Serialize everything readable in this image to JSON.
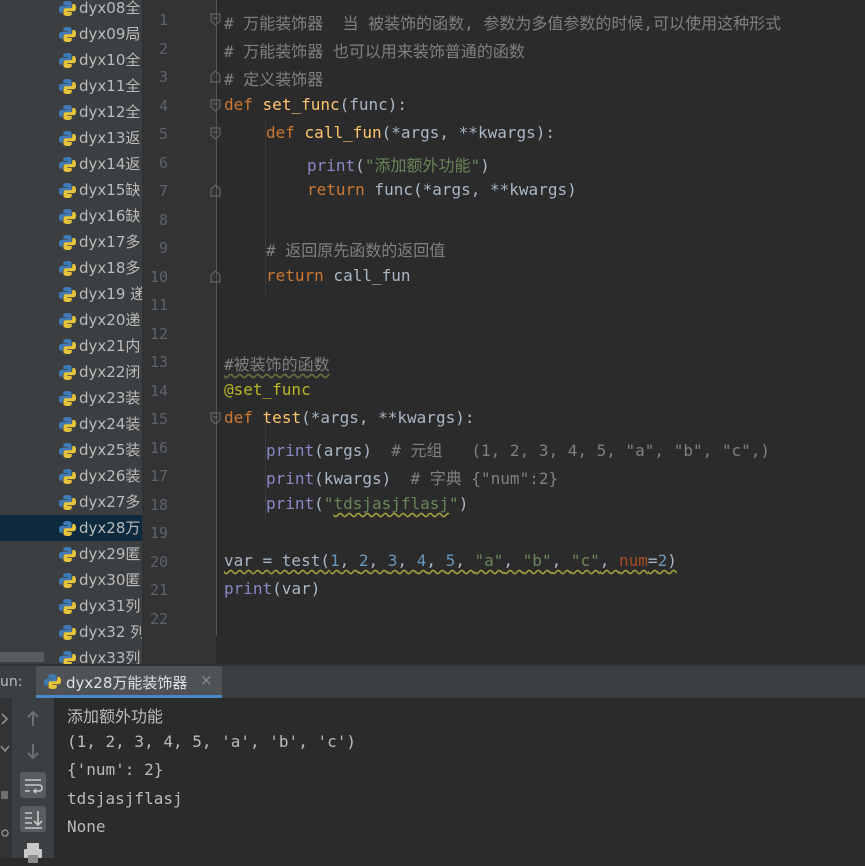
{
  "project_tree": {
    "items": [
      {
        "label": "dyx08全"
      },
      {
        "label": "dyx09局"
      },
      {
        "label": "dyx10全"
      },
      {
        "label": "dyx11全"
      },
      {
        "label": "dyx12全"
      },
      {
        "label": "dyx13返"
      },
      {
        "label": "dyx14返"
      },
      {
        "label": "dyx15缺"
      },
      {
        "label": "dyx16缺"
      },
      {
        "label": "dyx17多"
      },
      {
        "label": "dyx18多"
      },
      {
        "label": "dyx19 递"
      },
      {
        "label": "dyx20递"
      },
      {
        "label": "dyx21内"
      },
      {
        "label": "dyx22闭"
      },
      {
        "label": "dyx23装"
      },
      {
        "label": "dyx24装"
      },
      {
        "label": "dyx25装"
      },
      {
        "label": "dyx26装"
      },
      {
        "label": "dyx27多"
      },
      {
        "label": "dyx28万"
      },
      {
        "label": "dyx29匿"
      },
      {
        "label": "dyx30匿"
      },
      {
        "label": "dyx31列"
      },
      {
        "label": "dyx32 列"
      },
      {
        "label": "dyx33列"
      }
    ],
    "selected_index": 20
  },
  "editor": {
    "line_numbers": [
      "1",
      "2",
      "3",
      "4",
      "5",
      "6",
      "7",
      "8",
      "9",
      "10",
      "11",
      "12",
      "13",
      "14",
      "15",
      "16",
      "17",
      "18",
      "19",
      "20",
      "21",
      "22"
    ],
    "lines": {
      "l1": "# 万能装饰器  当 被装饰的函数, 参数为多值参数的时候,可以使用这种形式",
      "l2": "# 万能装饰器 也可以用来装饰普通的函数",
      "l3": "# 定义装饰器",
      "l4": {
        "kw": "def",
        "name": "set_func",
        "rest": "(func):"
      },
      "l5": {
        "kw": "def",
        "name": "call_fun",
        "rest": "(*args, **kwargs):"
      },
      "l6": {
        "fn": "print",
        "open": "(",
        "str": "\"添加额外功能\"",
        "close": ")"
      },
      "l7": {
        "kw": "return",
        "rest": " func(*args, **kwargs)"
      },
      "l9": "# 返回原先函数的返回值",
      "l10": {
        "kw": "return",
        "rest": " call_fun"
      },
      "l13": "#被装饰的函数",
      "l14": "@set_func",
      "l15": {
        "kw": "def",
        "name": "test",
        "rest": "(*args, **kwargs):"
      },
      "l16": {
        "fn": "print",
        "rest": "(args)  ",
        "comment": "# 元组   (1, 2, 3, 4, 5, \"a\", \"b\", \"c\",)"
      },
      "l17": {
        "fn": "print",
        "rest": "(kwargs)  ",
        "comment": "# 字典 {\"num\":2}"
      },
      "l18": {
        "fn": "print",
        "open": "(",
        "str_open": "\"",
        "str": "tdsjasjflasj",
        "str_close": "\"",
        "close": ")"
      },
      "l20": {
        "pre": "var = test(",
        "n1": "1",
        "n2": "2",
        "n3": "3",
        "n4": "4",
        "n5": "5",
        "s1": "\"a\"",
        "s2": "\"b\"",
        "s3": "\"c\"",
        "param": "num",
        "eq": "=",
        "n6": "2",
        "close": ")"
      },
      "l21": {
        "fn": "print",
        "rest": "(var)"
      }
    }
  },
  "run_panel": {
    "label": "un:",
    "tab_label": "dyx28万能装饰器",
    "tab_close": "×",
    "output": [
      "添加额外功能",
      "(1, 2, 3, 4, 5, 'a', 'b', 'c')",
      "{'num': 2}",
      "tdsjasjflasj",
      "None"
    ]
  },
  "colors": {
    "background": "#2b2b2b",
    "keyword": "#cc7832",
    "function_name": "#ffc66d",
    "string": "#6a8759",
    "number": "#6897bb",
    "comment": "#808080",
    "decorator": "#bbb529",
    "selection": "#0d293e"
  }
}
